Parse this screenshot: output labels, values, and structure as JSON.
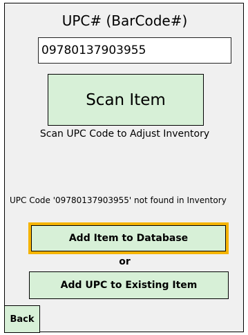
{
  "upc": {
    "label": "UPC# (BarCode#)",
    "value": "09780137903955"
  },
  "scan": {
    "button_label": "Scan Item",
    "hint": "Scan UPC Code to Adjust Inventory"
  },
  "message": {
    "not_found": "UPC Code '09780137903955' not found in Inventory"
  },
  "actions": {
    "add_item_label": "Add Item to Database",
    "or_label": "or",
    "add_upc_label": "Add UPC to Existing Item"
  },
  "nav": {
    "back_label": "Back"
  },
  "colors": {
    "panel_background": "#f0f0f0",
    "button_green": "#d7f0d7",
    "focus_highlight": "#f5b400"
  }
}
